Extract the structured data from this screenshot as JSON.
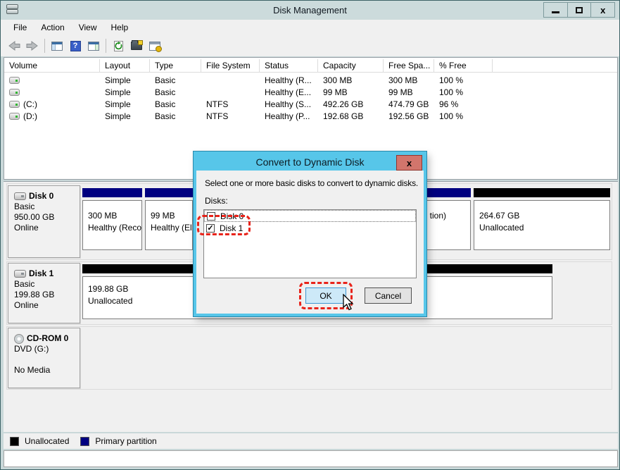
{
  "window": {
    "title": "Disk Management"
  },
  "titlebar_controls": {
    "close_glyph": "x"
  },
  "menu": {
    "items": [
      "File",
      "Action",
      "View",
      "Help"
    ]
  },
  "toolbar": {
    "help_glyph": "?"
  },
  "columns": [
    "Volume",
    "Layout",
    "Type",
    "File System",
    "Status",
    "Capacity",
    "Free Spa...",
    "% Free"
  ],
  "volumes": [
    {
      "name": "",
      "layout": "Simple",
      "type": "Basic",
      "fs": "",
      "status": "Healthy (R...",
      "capacity": "300 MB",
      "free": "300 MB",
      "pct": "100 %"
    },
    {
      "name": "",
      "layout": "Simple",
      "type": "Basic",
      "fs": "",
      "status": "Healthy (E...",
      "capacity": "99 MB",
      "free": "99 MB",
      "pct": "100 %"
    },
    {
      "name": "(C:)",
      "layout": "Simple",
      "type": "Basic",
      "fs": "NTFS",
      "status": "Healthy (S...",
      "capacity": "492.26 GB",
      "free": "474.79 GB",
      "pct": "96 %"
    },
    {
      "name": "(D:)",
      "layout": "Simple",
      "type": "Basic",
      "fs": "NTFS",
      "status": "Healthy (P...",
      "capacity": "192.68 GB",
      "free": "192.56 GB",
      "pct": "100 %"
    }
  ],
  "disks": {
    "disk0": {
      "name": "Disk 0",
      "kind": "Basic",
      "size": "950.00 GB",
      "state": "Online",
      "p1": {
        "size": "300 MB",
        "status": "Healthy (Reco"
      },
      "p2": {
        "size": "99 MB",
        "status": "Healthy (El"
      },
      "p3": {
        "size": "",
        "status": "tion)"
      },
      "p4": {
        "size": "264.67 GB",
        "status": "Unallocated"
      }
    },
    "disk1": {
      "name": "Disk 1",
      "kind": "Basic",
      "size": "199.88 GB",
      "state": "Online",
      "p1": {
        "size": "199.88 GB",
        "status": "Unallocated"
      }
    },
    "cdrom": {
      "name": "CD-ROM 0",
      "kind": "DVD (G:)",
      "state": "No Media"
    }
  },
  "legend": {
    "unallocated": "Unallocated",
    "primary": "Primary partition"
  },
  "dialog": {
    "title": "Convert to Dynamic Disk",
    "close_glyph": "x",
    "instruction": "Select one or more basic disks to convert to dynamic disks.",
    "disks_label": "Disks:",
    "items": [
      {
        "label": "Disk 0",
        "checked": false
      },
      {
        "label": "Disk 1",
        "checked": true
      }
    ],
    "ok_label": "OK",
    "cancel_label": "Cancel"
  },
  "colors": {
    "primary_partition": "#000080",
    "unallocated": "#000000",
    "dialog_accent": "#57c6e9",
    "annotation_red": "#e8231a"
  }
}
